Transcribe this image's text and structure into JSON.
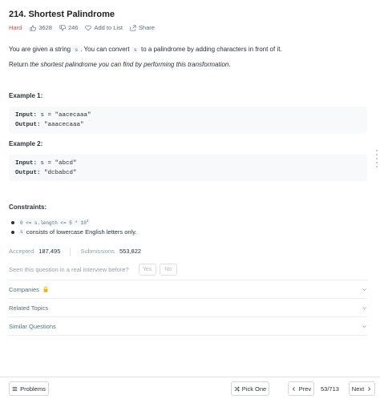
{
  "problem": {
    "title": "214. Shortest Palindrome",
    "difficulty": "Hard",
    "likes": "3628",
    "dislikes": "246",
    "add_to_list": "Add to List",
    "share": "Share"
  },
  "description": {
    "line1_pre": "You are given a string",
    "line1_code": "s",
    "line1_post": ". You can convert",
    "line1_code2": "s",
    "line1_end": "to a palindrome by adding characters in front of it.",
    "line2_pre": "Return",
    "line2_em": "the shortest palindrome you can find by performing this transformation",
    "line2_end": "."
  },
  "examples": [
    {
      "title": "Example 1:",
      "input_label": "Input:",
      "input": "s = \"aacecaaa\"",
      "output_label": "Output:",
      "output": "\"aaacecaaa\""
    },
    {
      "title": "Example 2:",
      "input_label": "Input:",
      "input": "s = \"abcd\"",
      "output_label": "Output:",
      "output": "\"dcbabcd\""
    }
  ],
  "constraints": {
    "title": "Constraints:",
    "c1": "0 <= s.length <= 5 * 10",
    "c1_sup": "4",
    "c2_code": "s",
    "c2_text": "consists of lowercase English letters only."
  },
  "stats": {
    "accepted_label": "Accepted",
    "accepted_value": "187,495",
    "submissions_label": "Submissions",
    "submissions_value": "553,822"
  },
  "interview": {
    "question": "Seen this question in a real interview before?",
    "yes": "Yes",
    "no": "No"
  },
  "sections": {
    "companies": "Companies",
    "related_topics": "Related Topics",
    "similar_questions": "Similar Questions"
  },
  "bottom": {
    "problems": "Problems",
    "pick_one": "Pick One",
    "prev": "Prev",
    "pager": "53/713",
    "next": "Next"
  },
  "colors": {
    "hard": "#ef4743",
    "lock": "#f0b400"
  }
}
